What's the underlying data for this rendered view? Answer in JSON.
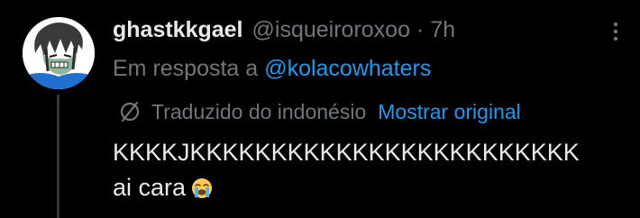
{
  "tweet": {
    "display_name": "ghastkkgael",
    "handle": "@isqueiroroxoo",
    "separator": "·",
    "time": "7h",
    "reply_prefix": "Em resposta a",
    "reply_to": "@kolacowhaters",
    "translation": {
      "label": "Traduzido do indonésio",
      "show_original": "Mostrar original"
    },
    "text_line_1": "KKKKJKKKKKKKKKKKKKKKKKKKKKKKK",
    "text_line_2": "ai cara",
    "emoji": "loudly-crying-face"
  },
  "icons": {
    "more": "more-options-icon",
    "translate": "translate-globe-icon"
  },
  "colors": {
    "background": "#000000",
    "text_primary": "#e7e9ea",
    "text_secondary": "#71767b",
    "link": "#1d9bf0",
    "thread_line": "#333639"
  }
}
